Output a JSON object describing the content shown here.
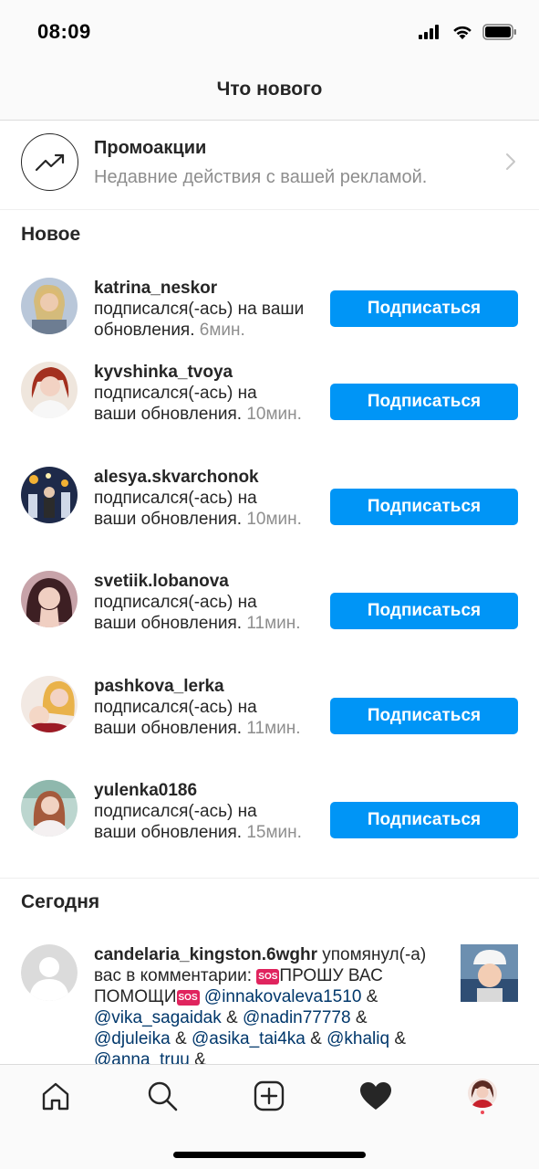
{
  "status_bar": {
    "time": "08:09"
  },
  "header": {
    "title": "Что нового"
  },
  "promo": {
    "title": "Промоакции",
    "subtitle": "Недавние действия с вашей рекламой.",
    "icon": "trending-up-icon"
  },
  "sections": {
    "new": "Новое",
    "today": "Сегодня"
  },
  "follow_label": "Подписаться",
  "notifications": [
    {
      "username": "katrina_neskor",
      "action": "подписался(-ась) на ваши обновления.",
      "time": "6мин."
    },
    {
      "username": "kyvshinka_tvoya",
      "action": "подписался(-ась) на ваши обновления.",
      "time": "10мин."
    },
    {
      "username": "alesya.skvarchonok",
      "action": "подписался(-ась) на ваши обновления.",
      "time": "10мин."
    },
    {
      "username": "svetiik.lobanova",
      "action": "подписался(-ась) на ваши обновления.",
      "time": "11мин."
    },
    {
      "username": "pashkova_lerka",
      "action": "подписался(-ась) на ваши обновления.",
      "time": "11мин."
    },
    {
      "username": "yulenka0186",
      "action": "подписался(-ась) на ваши обновления.",
      "time": "15мин."
    }
  ],
  "mention": {
    "username": "candelaria_kingston.6wghr",
    "action": "упомянул(-а) вас в комментарии:",
    "sos": "SOS",
    "text1": "ПРОШУ ВАС ПОМОЩИ",
    "tags": [
      "@innakovaleva1510",
      "@vika_sagaidak",
      "@nadin77778",
      "@djuleika",
      "@asika_tai4ka",
      "@khaliq",
      "@anna_truu"
    ],
    "amp": "&"
  },
  "tabbar": [
    "home-icon",
    "search-icon",
    "new-post-icon",
    "activity-heart-icon",
    "profile-avatar"
  ],
  "colors": {
    "accent": "#0095f6",
    "text": "#262626",
    "muted": "#8e8e8e",
    "link": "#00376b"
  }
}
